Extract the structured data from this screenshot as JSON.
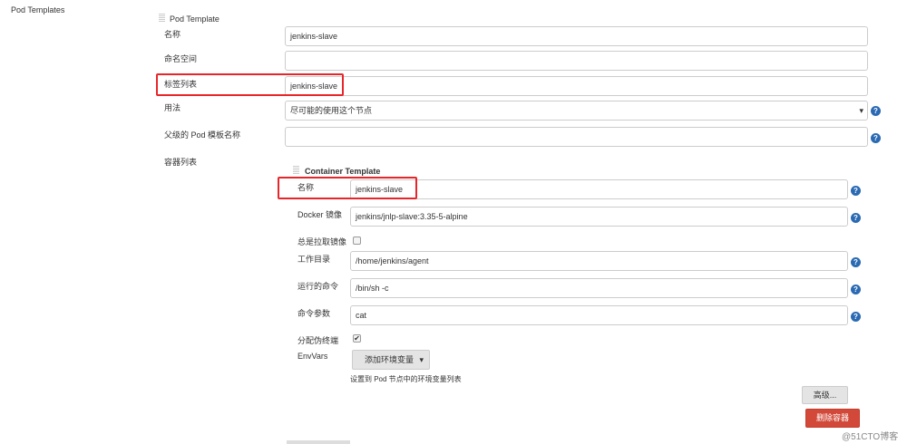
{
  "section_title": "Pod Templates",
  "pod_template": {
    "title": "Pod Template",
    "fields": [
      {
        "label": "名称",
        "value": "jenkins-slave"
      },
      {
        "label": "命名空间",
        "value": ""
      },
      {
        "label": "标签列表",
        "value": "jenkins-slave"
      },
      {
        "label": "用法",
        "value": "尽可能的使用这个节点"
      },
      {
        "label": "父级的 Pod 模板名称",
        "value": ""
      }
    ],
    "containers_label": "容器列表"
  },
  "container_template": {
    "title": "Container Template",
    "name": {
      "label": "名称",
      "value": "jenkins-slave"
    },
    "image": {
      "label": "Docker 镜像",
      "value": "jenkins/jnlp-slave:3.35-5-alpine"
    },
    "always_pull": {
      "label": "总是拉取镜像",
      "checked": false
    },
    "workdir": {
      "label": "工作目录",
      "value": "/home/jenkins/agent"
    },
    "command": {
      "label": "运行的命令",
      "value": "/bin/sh -c"
    },
    "args": {
      "label": "命令参数",
      "value": "cat"
    },
    "tty": {
      "label": "分配伪终端",
      "checked": true,
      "mark": "✔"
    },
    "envvars": {
      "label": "EnvVars",
      "add_button": "添加环境变量",
      "hint": "设置到 Pod 节点中的环境变量列表"
    },
    "advanced_button": "高级...",
    "delete_button": "删除容器"
  },
  "help_glyph": "?",
  "dropdown_glyph": "▾",
  "watermark": "@51CTO博客",
  "colors": {
    "accent": "#2a6ab3",
    "danger": "#d24939",
    "highlight": "#e8262a"
  }
}
